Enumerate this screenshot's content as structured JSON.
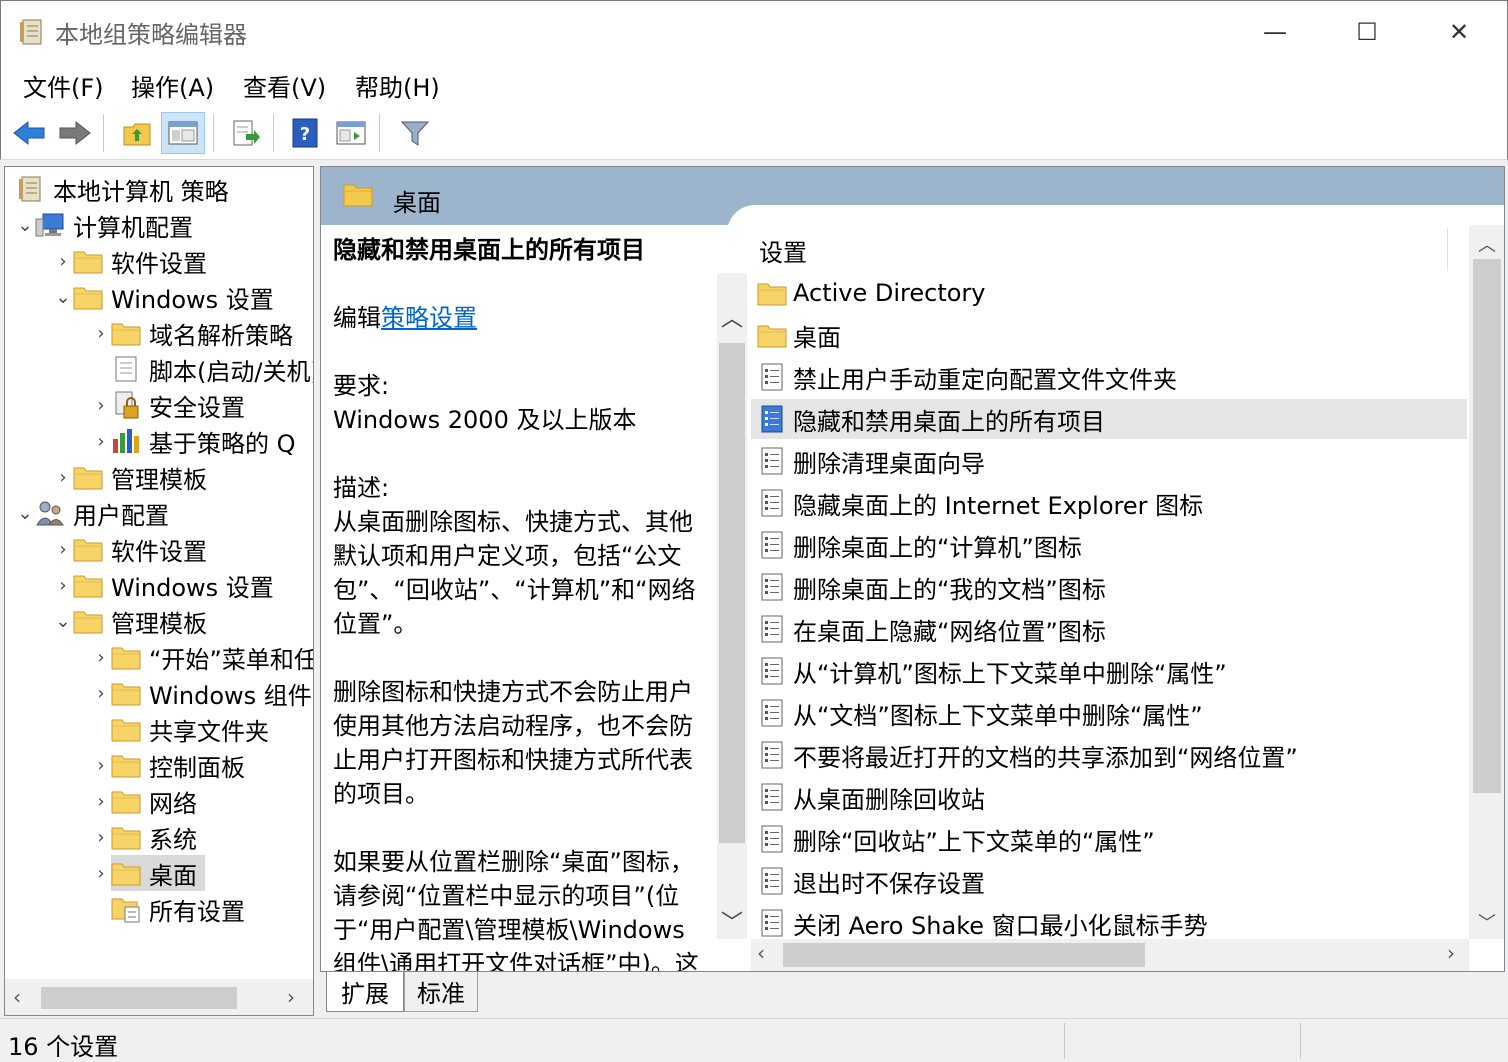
{
  "window": {
    "title": "本地组策略编辑器",
    "minimize": "—",
    "maximize": "☐",
    "close": "✕"
  },
  "menu": [
    "文件(F)",
    "操作(A)",
    "查看(V)",
    "帮助(H)"
  ],
  "toolbar": {
    "icons": [
      "back-arrow-icon",
      "forward-arrow-icon",
      "up-folder-icon",
      "show-hide-tree-icon",
      "export-list-icon",
      "help-icon",
      "console-view-icon",
      "filter-icon"
    ]
  },
  "tree": {
    "items": [
      {
        "label": "本地计算机 策略",
        "arrow": ""
      },
      {
        "label": "计算机配置",
        "arrow": "⌄"
      },
      {
        "label": "软件设置",
        "arrow": "›"
      },
      {
        "label": "Windows 设置",
        "arrow": "⌄"
      },
      {
        "label": "域名解析策略",
        "arrow": "›"
      },
      {
        "label": "脚本(启动/关机)",
        "arrow": ""
      },
      {
        "label": "安全设置",
        "arrow": "›"
      },
      {
        "label": "基于策略的 Q",
        "arrow": "›"
      },
      {
        "label": "管理模板",
        "arrow": "›"
      },
      {
        "label": "用户配置",
        "arrow": "⌄"
      },
      {
        "label": "软件设置",
        "arrow": "›"
      },
      {
        "label": "Windows 设置",
        "arrow": "›"
      },
      {
        "label": "管理模板",
        "arrow": "⌄"
      },
      {
        "label": "“开始”菜单和任务栏",
        "arrow": "›"
      },
      {
        "label": "Windows 组件",
        "arrow": "›"
      },
      {
        "label": "共享文件夹",
        "arrow": ""
      },
      {
        "label": "控制面板",
        "arrow": "›"
      },
      {
        "label": "网络",
        "arrow": "›"
      },
      {
        "label": "系统",
        "arrow": "›"
      },
      {
        "label": "桌面",
        "arrow": "›"
      },
      {
        "label": "所有设置",
        "arrow": ""
      }
    ]
  },
  "content": {
    "header_title": "桌面",
    "description": {
      "title": "隐藏和禁用桌面上的所有项目",
      "edit_prefix": "编辑",
      "edit_link": "策略设置",
      "requirements_label": "要求:",
      "requirements_value": "Windows 2000 及以上版本",
      "description_label": "描述:",
      "paragraph1": "从桌面删除图标、快捷方式、其他默认项和用户定义项，包括“公文包”、“回收站”、“计算机”和“网络位置”。",
      "paragraph2": "删除图标和快捷方式不会防止用户使用其他方法启动程序，也不会防止用户打开图标和快捷方式所代表的项目。",
      "paragraph3": "如果要从位置栏删除“桌面”图标，请参阅“位置栏中显示的项目”(位于“用户配置\\管理模板\\Windows 组件\\通用打开文件对话框”中)。这将"
    },
    "list_header": "设置",
    "settings": [
      {
        "label": "Active Directory",
        "type": "folder"
      },
      {
        "label": "桌面",
        "type": "folder"
      },
      {
        "label": "禁止用户手动重定向配置文件文件夹",
        "type": "policy"
      },
      {
        "label": "隐藏和禁用桌面上的所有项目",
        "type": "policy-selected"
      },
      {
        "label": "删除清理桌面向导",
        "type": "policy"
      },
      {
        "label": "隐藏桌面上的 Internet Explorer 图标",
        "type": "policy"
      },
      {
        "label": "删除桌面上的“计算机”图标",
        "type": "policy"
      },
      {
        "label": "删除桌面上的“我的文档”图标",
        "type": "policy"
      },
      {
        "label": "在桌面上隐藏“网络位置”图标",
        "type": "policy"
      },
      {
        "label": "从“计算机”图标上下文菜单中删除“属性”",
        "type": "policy"
      },
      {
        "label": "从“文档”图标上下文菜单中删除“属性”",
        "type": "policy"
      },
      {
        "label": "不要将最近打开的文档的共享添加到“网络位置”",
        "type": "policy"
      },
      {
        "label": "从桌面删除回收站",
        "type": "policy"
      },
      {
        "label": "删除“回收站”上下文菜单的“属性”",
        "type": "policy"
      },
      {
        "label": "退出时不保存设置",
        "type": "policy"
      },
      {
        "label": "关闭 Aero Shake 窗口最小化鼠标手势",
        "type": "policy"
      }
    ]
  },
  "tabs": [
    "扩展",
    "标准"
  ],
  "status": "16 个设置",
  "colors": {
    "header_bg": "#9db4cd",
    "folder_yellow": "#f2c94c",
    "selection": "#d9d9d9",
    "link": "#0066cc"
  }
}
